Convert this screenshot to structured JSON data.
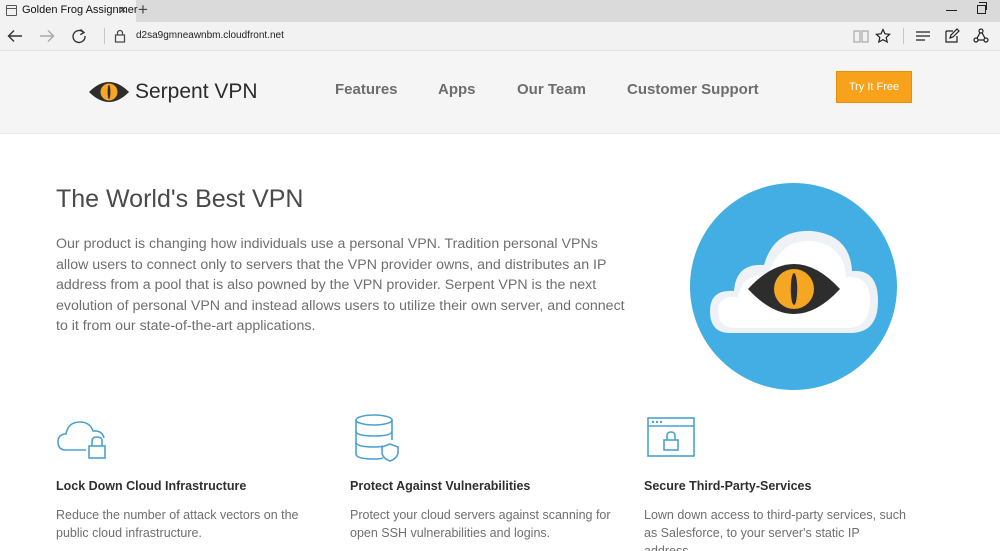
{
  "browser": {
    "tab_title": "Golden Frog Assignmer",
    "tab_close": "×",
    "new_tab": "+",
    "url": "d2sa9gmneawnbm.cloudfront.net"
  },
  "header": {
    "brand_name": "Serpent VPN",
    "nav": [
      "Features",
      "Apps",
      "Our Team",
      "Customer Support"
    ],
    "cta_label": "Try It Free"
  },
  "hero": {
    "title": "The World's Best VPN",
    "body": "Our product is changing how individuals use a personal VPN. Tradition personal VPNs allow users to connect only to servers that the VPN provider owns, and distributes an IP address from a pool that is also powned by the VPN provider. Serpent VPN is the next evolution of personal VPN and instead allows users to utilize their own server, and connect to it from our state-of-the-art applications."
  },
  "features": [
    {
      "icon": "cloud-lock-icon",
      "title": "Lock Down Cloud Infrastructure",
      "text": "Reduce the number of attack vectors on the public cloud infrastructure."
    },
    {
      "icon": "database-shield-icon",
      "title": "Protect Against Vulnerabilities",
      "text": "Protect your cloud servers against scanning for open SSH vulnerabilities and logins."
    },
    {
      "icon": "browser-lock-icon",
      "title": "Secure Third-Party-Services",
      "text": "Lown down access to third-party services, such as Salesforce, to your server's static IP address."
    }
  ],
  "colors": {
    "accent_orange": "#f8a11a",
    "brand_blue": "#43aee3",
    "eye_yellow": "#f5a623",
    "eye_dark": "#2d2d2d",
    "icon_blue": "#4aa3cf"
  }
}
